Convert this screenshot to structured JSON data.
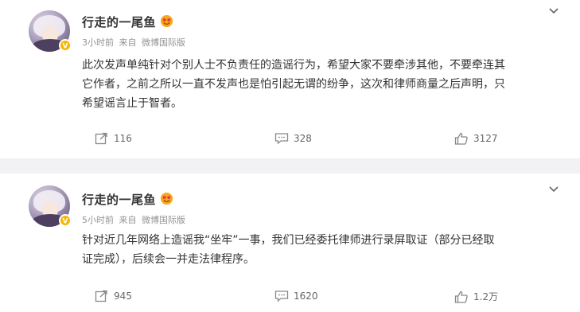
{
  "posts": [
    {
      "username": "行走的一尾鱼",
      "time": "3小时前",
      "source_prefix": "来自",
      "source": "微博国际版",
      "text_lines": [
        "此次发声单纯针对个别人士不负责任的造谣行为，希望大家不要牵涉其他，不要牵连其",
        "它作者，之前之所以一直不发声也是怕引起无谓的纷争，这次和律师商量之后声明，只",
        "希望谣言止于智者。"
      ],
      "reposts": "116",
      "comments": "328",
      "likes": "3127"
    },
    {
      "username": "行走的一尾鱼",
      "time": "5小时前",
      "source_prefix": "来自",
      "source": "微博国际版",
      "text_lines": [
        "针对近几年网络上造谣我“坐牢”一事，我们已经委托律师进行录屏取证（部分已经取",
        "证完成），后续会一并走法律程序。"
      ],
      "reposts": "945",
      "comments": "1620",
      "likes": "1.2万"
    }
  ],
  "icons": {
    "verified": "verified-badge-icon",
    "vip": "vip-emoji-icon",
    "menu": "chevron-down-icon",
    "repost": "repost-icon",
    "comment": "comment-icon",
    "like": "thumbs-up-icon"
  },
  "colors": {
    "text": "#333333",
    "meta": "#939393",
    "divider": "#f2f2f5",
    "verified": "#f7b500"
  }
}
